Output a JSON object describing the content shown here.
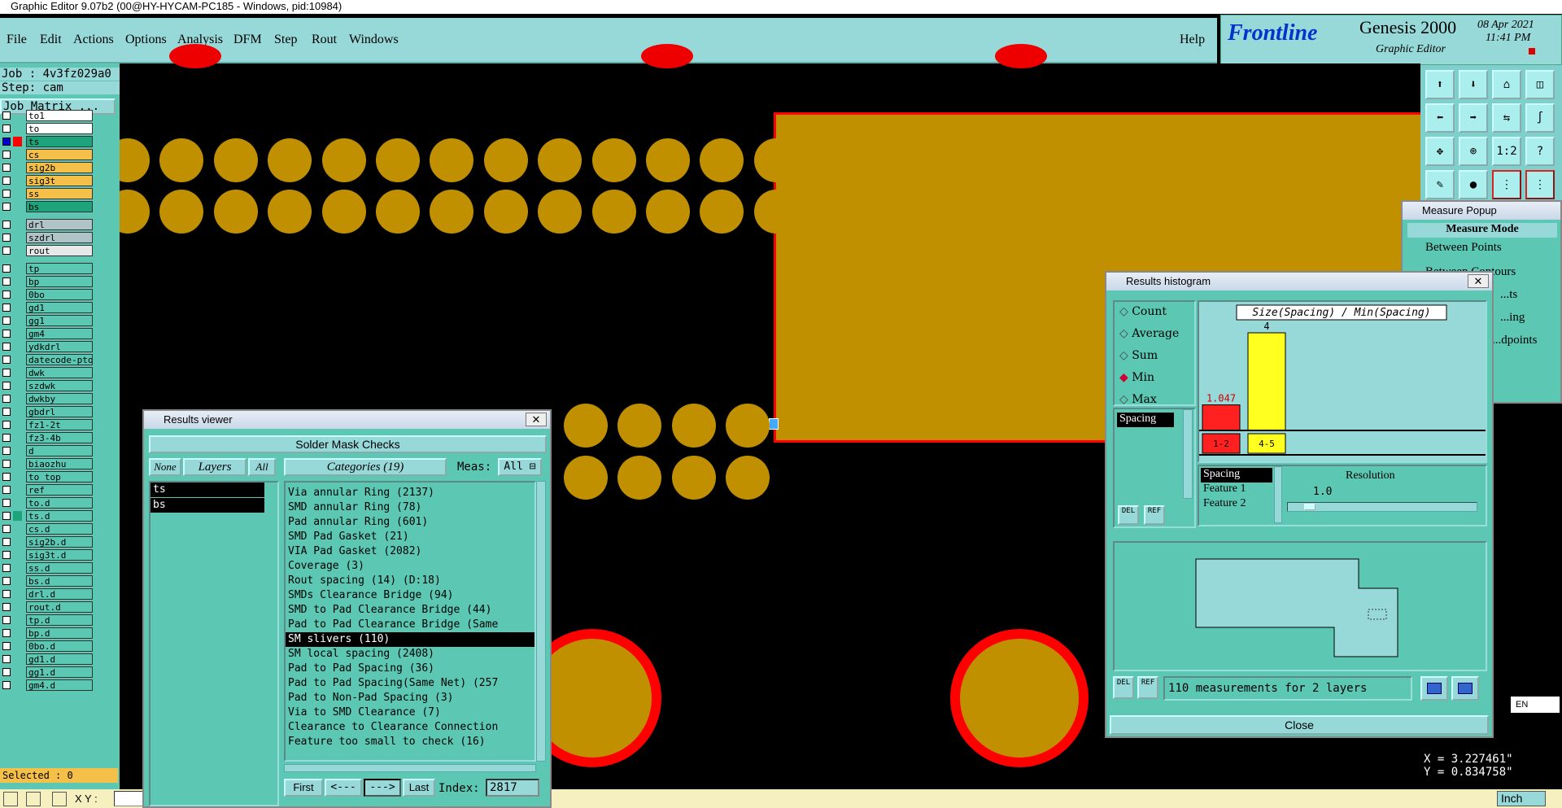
{
  "title_bar": "Graphic Editor 9.07b2 (00@HY-HYCAM-PC185 - Windows, pid:10984)",
  "menu": [
    "File",
    "Edit",
    "Actions",
    "Options",
    "Analysis",
    "DFM",
    "Step",
    "Rout",
    "Windows"
  ],
  "help": "Help",
  "brand": {
    "logo": "Frontline",
    "product": "Genesis 2000",
    "subtitle": "Graphic Editor",
    "date": "08 Apr 2021",
    "time": "11:41 PM"
  },
  "job": {
    "job_line": "Job : 4v3fz029a0",
    "step_line": "Step: cam",
    "matrix_button": "Job Matrix ..."
  },
  "layers": [
    {
      "name": "to1",
      "color": "#ffffff"
    },
    {
      "name": "to",
      "color": "#ffffff"
    },
    {
      "name": "ts",
      "color": "#1fa37a"
    },
    {
      "name": "cs",
      "color": "#f5c04a"
    },
    {
      "name": "sig2b",
      "color": "#f5c04a"
    },
    {
      "name": "sig3t",
      "color": "#f5c04a"
    },
    {
      "name": "ss",
      "color": "#f5c04a"
    },
    {
      "name": "bs",
      "color": "#1fa37a"
    },
    {
      "name": "drl",
      "color": "#b0c4c8"
    },
    {
      "name": "szdrl",
      "color": "#b0c4c8"
    },
    {
      "name": "rout",
      "color": "#e8e8e8"
    },
    {
      "name": "tp",
      "color": "#5cc8b3"
    },
    {
      "name": "bp",
      "color": "#5cc8b3"
    },
    {
      "name": "0bo",
      "color": "#5cc8b3"
    },
    {
      "name": "gd1",
      "color": "#5cc8b3"
    },
    {
      "name": "gg1",
      "color": "#5cc8b3"
    },
    {
      "name": "gm4",
      "color": "#5cc8b3"
    },
    {
      "name": "ydkdrl",
      "color": "#5cc8b3"
    },
    {
      "name": "datecode-pto",
      "color": "#5cc8b3"
    },
    {
      "name": "dwk",
      "color": "#5cc8b3"
    },
    {
      "name": "szdwk",
      "color": "#5cc8b3"
    },
    {
      "name": "dwkby",
      "color": "#5cc8b3"
    },
    {
      "name": "gbdrl",
      "color": "#5cc8b3"
    },
    {
      "name": "fz1-2t",
      "color": "#5cc8b3"
    },
    {
      "name": "fz3-4b",
      "color": "#5cc8b3"
    },
    {
      "name": "d",
      "color": "#5cc8b3"
    },
    {
      "name": "biaozhu",
      "color": "#5cc8b3"
    },
    {
      "name": "to_top",
      "color": "#5cc8b3"
    },
    {
      "name": "ref",
      "color": "#5cc8b3"
    },
    {
      "name": "to.d",
      "color": "#5cc8b3"
    },
    {
      "name": "ts.d",
      "color": "#5cc8b3"
    },
    {
      "name": "cs.d",
      "color": "#5cc8b3"
    },
    {
      "name": "sig2b.d",
      "color": "#5cc8b3"
    },
    {
      "name": "sig3t.d",
      "color": "#5cc8b3"
    },
    {
      "name": "ss.d",
      "color": "#5cc8b3"
    },
    {
      "name": "bs.d",
      "color": "#5cc8b3"
    },
    {
      "name": "drl.d",
      "color": "#5cc8b3"
    },
    {
      "name": "rout.d",
      "color": "#5cc8b3"
    },
    {
      "name": "tp.d",
      "color": "#5cc8b3"
    },
    {
      "name": "bp.d",
      "color": "#5cc8b3"
    },
    {
      "name": "0bo.d",
      "color": "#5cc8b3"
    },
    {
      "name": "gd1.d",
      "color": "#5cc8b3"
    },
    {
      "name": "gg1.d",
      "color": "#5cc8b3"
    },
    {
      "name": "gm4.d",
      "color": "#5cc8b3"
    }
  ],
  "selected": "Selected : 0",
  "xy_label": "X Y :",
  "units": "Inch",
  "results_viewer": {
    "title": "Results viewer",
    "header": "Solder Mask Checks",
    "none_btn": "None",
    "layers_btn": "Layers",
    "all_btn": "All",
    "categories_btn": "Categories (19)",
    "meas_label": "Meas:",
    "meas_value": "All",
    "layers": [
      "ts",
      "bs"
    ],
    "categories": [
      "Via annular Ring (2137)",
      "SMD annular Ring (78)",
      "Pad annular Ring (601)",
      "SMD Pad Gasket (21)",
      "VIA Pad Gasket (2082)",
      "Coverage (3)",
      "Rout spacing (14)         (D:18)",
      "SMDs Clearance Bridge (94)",
      "SMD to Pad Clearance Bridge (44)",
      "Pad to Pad Clearance Bridge (Same",
      "SM slivers (110)",
      "SM local spacing (2408)",
      "Pad to Pad Spacing (36)",
      "Pad to Pad Spacing(Same Net) (257",
      "Pad to Non-Pad Spacing (3)",
      "Via to SMD Clearance (7)",
      "Clearance to Clearance Connection",
      "Feature too small to check (16)"
    ],
    "selected_category": "SM slivers (110)",
    "nav": {
      "first": "First",
      "prev": "<---",
      "next": "--->",
      "last": "Last",
      "index_label": "Index:",
      "index_value": "2817"
    }
  },
  "histogram": {
    "title": "Results histogram",
    "modes": [
      "Count",
      "Average",
      "Sum",
      "Min",
      "Max"
    ],
    "selected_mode": "Min",
    "field": "Spacing",
    "chart_title": "Size(Spacing) / Min(Spacing)",
    "del": "DEL",
    "ref": "REF",
    "resolution_label": "Resolution",
    "resolution_value": "1.0",
    "fields": [
      "Spacing",
      "Feature 1",
      "Feature 2"
    ],
    "status": "110 measurements for 2 layers",
    "close": "Close"
  },
  "chart_data": {
    "type": "bar",
    "title": "Size(Spacing) / Min(Spacing)",
    "categories": [
      "1-2",
      "4-5"
    ],
    "values": [
      1.047,
      4
    ],
    "data_labels": [
      "1.047",
      "4"
    ],
    "colors": [
      "#ff2020",
      "#ffff20"
    ]
  },
  "measure_popup": {
    "title": "Measure Popup",
    "mode_header": "Measure Mode",
    "options": [
      "Between Points",
      "Between Contours",
      "...ts",
      "...ing",
      "...dpoints"
    ]
  },
  "coords": {
    "x": "X = 3.227461\"",
    "y": "Y = 0.834758\""
  },
  "lang": "EN"
}
